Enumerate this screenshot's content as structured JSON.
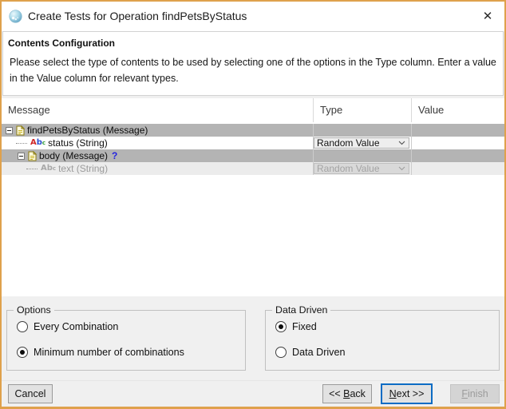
{
  "window": {
    "title": "Create Tests for Operation findPetsByStatus"
  },
  "icons": {
    "close": "✕",
    "string_a": "A",
    "string_b": "b",
    "string_c": "c"
  },
  "header": {
    "title": "Contents Configuration",
    "description_line1": "Please select the type of contents to be used by selecting one of the options in the Type column. Enter a value",
    "description_line2": "in the Value column for relevant types."
  },
  "table": {
    "columns": {
      "message": "Message",
      "type": "Type",
      "value": "Value"
    },
    "rows": [
      {
        "label": "findPetsByStatus (Message)",
        "selected": true,
        "type_value": "",
        "value": ""
      },
      {
        "label": "status (String)",
        "selected": false,
        "type_value": "Random Value",
        "value": ""
      },
      {
        "label": "body (Message)",
        "suffix": "?",
        "selected": true,
        "type_value": "",
        "value": ""
      },
      {
        "label": "text (String)",
        "selected": false,
        "disabled": true,
        "type_value": "Random Value",
        "value": ""
      }
    ]
  },
  "options_group": {
    "title": "Options",
    "radios": [
      {
        "label": "Every Combination",
        "selected": false
      },
      {
        "label": "Minimum number of combinations",
        "selected": true
      }
    ]
  },
  "data_driven_group": {
    "title": "Data Driven",
    "radios": [
      {
        "label": "Fixed",
        "selected": true
      },
      {
        "label": "Data Driven",
        "selected": false
      }
    ]
  },
  "buttons": {
    "cancel": "Cancel",
    "back_pre": "<< ",
    "back_mn": "B",
    "back_post": "ack",
    "next_mn": "N",
    "next_post": "ext >>",
    "finish_mn": "F",
    "finish_post": "inish",
    "next_focused": true,
    "finish_disabled": true
  }
}
